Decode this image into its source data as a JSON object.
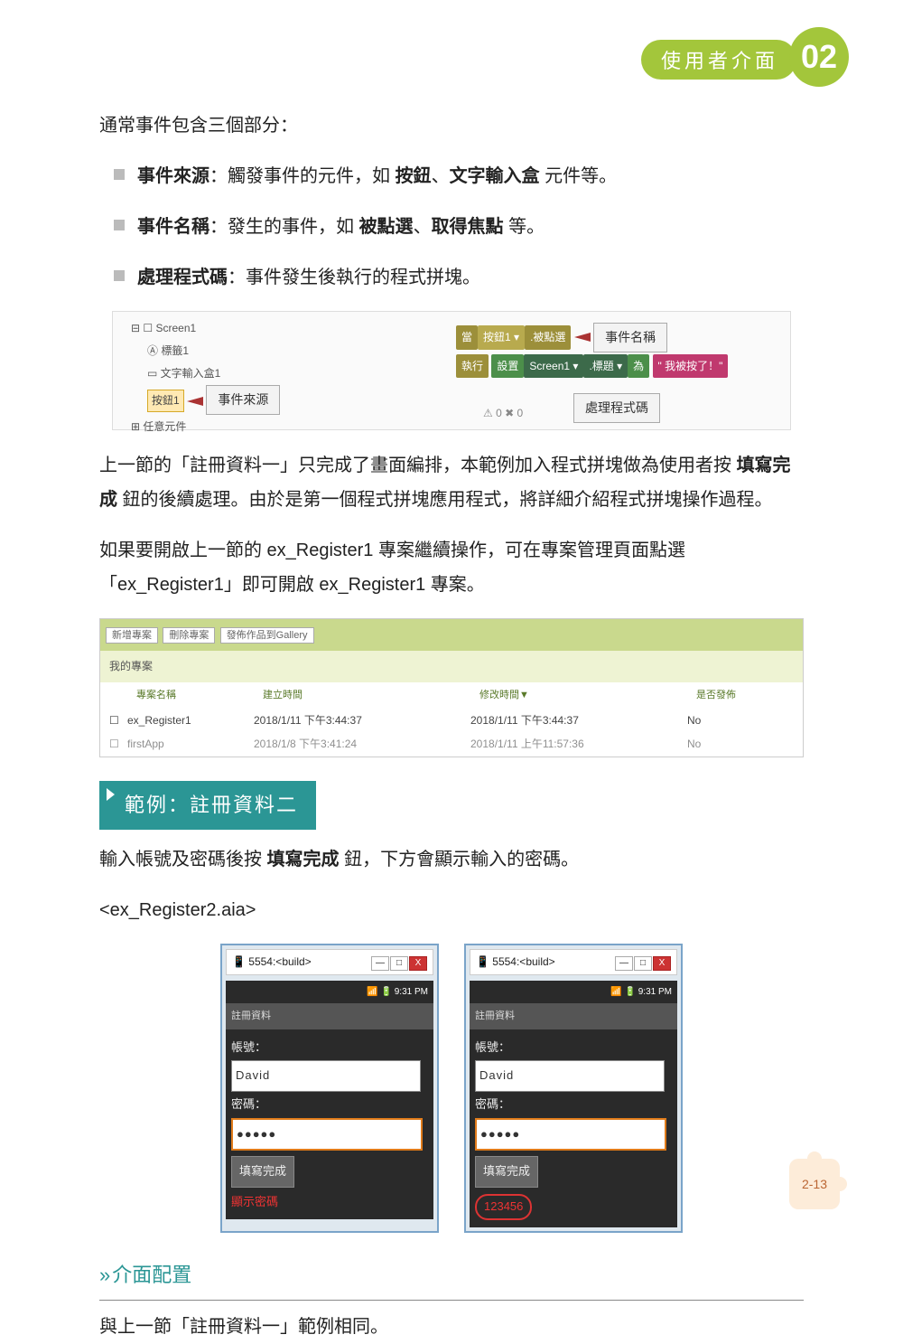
{
  "header": {
    "chapter_label": "使用者介面",
    "chapter_no": "02"
  },
  "intro": "通常事件包含三個部分：",
  "bullets": [
    {
      "term": "事件來源",
      "after1": "：觸發事件的元件，如 ",
      "b1": "按鈕",
      "sep": "、",
      "b2": "文字輸入盒",
      "after2": " 元件等。"
    },
    {
      "term": "事件名稱",
      "after1": "：發生的事件，如 ",
      "b1": "被點選",
      "sep": "、",
      "b2": "取得焦點",
      "after2": " 等。"
    },
    {
      "term": "處理程式碼",
      "after1": "：事件發生後執行的程式拼塊。",
      "b1": "",
      "sep": "",
      "b2": "",
      "after2": ""
    }
  ],
  "tree": {
    "root": "Screen1",
    "label": "標籤1",
    "textbox": "文字輸入盒1",
    "button": "按鈕1",
    "any": "任意元件"
  },
  "annot": {
    "src": "事件來源",
    "name": "事件名稱",
    "code": "處理程式碼"
  },
  "blocks": {
    "when": "當",
    "btn": "按鈕1 ▾",
    "click": ".被點選",
    "do": "執行",
    "set": "設置",
    "screen": "Screen1 ▾",
    "title": ".標題 ▾",
    "to": "為",
    "text": "\" 我被按了！\""
  },
  "warn": "⚠ 0     ✖ 0",
  "para2a": "上一節的「註冊資料一」只完成了畫面編排，本範例加入程式拼塊做為使用者按 ",
  "para2b": "填寫完成",
  "para2c": " 鈕的後續處理。由於是第一個程式拼塊應用程式，將詳細介紹程式拼塊操作過程。",
  "para3": "如果要開啟上一節的 ex_Register1 專案繼續操作，可在專案管理頁面點選「ex_Register1」即可開啟 ex_Register1 專案。",
  "panel": {
    "btns": [
      "新增專案",
      "刪除專案",
      "發佈作品到Gallery"
    ],
    "mine": "我的專案",
    "cols": [
      "專案名稱",
      "建立時間",
      "修改時間▼",
      "是否發佈"
    ],
    "rows": [
      {
        "name": "ex_Register1",
        "created": "2018/1/11 下午3:44:37",
        "modified": "2018/1/11 下午3:44:37",
        "pub": "No"
      },
      {
        "name": "firstApp",
        "created": "2018/1/8 下午3:41:24",
        "modified": "2018/1/11 上午11:57:36",
        "pub": "No"
      }
    ]
  },
  "example_tag": "範例：註冊資料二",
  "example_p1a": "輸入帳號及密碼後按 ",
  "example_p1b": "填寫完成",
  "example_p1c": " 鈕，下方會顯示輸入的密碼。",
  "example_file": "<ex_Register2.aia>",
  "phone": {
    "title": "5554:<build>",
    "time": "9:31 PM",
    "bar": "註冊資料",
    "acc": "帳號：",
    "accv": "David",
    "pwd": "密碼：",
    "pwdv": "●●●●●",
    "btn": "填寫完成",
    "hint": "顯示密碼",
    "val": "123456"
  },
  "sec2": "介面配置",
  "sec2_p": "與上一節「註冊資料一」範例相同。",
  "pageno": "2-13"
}
